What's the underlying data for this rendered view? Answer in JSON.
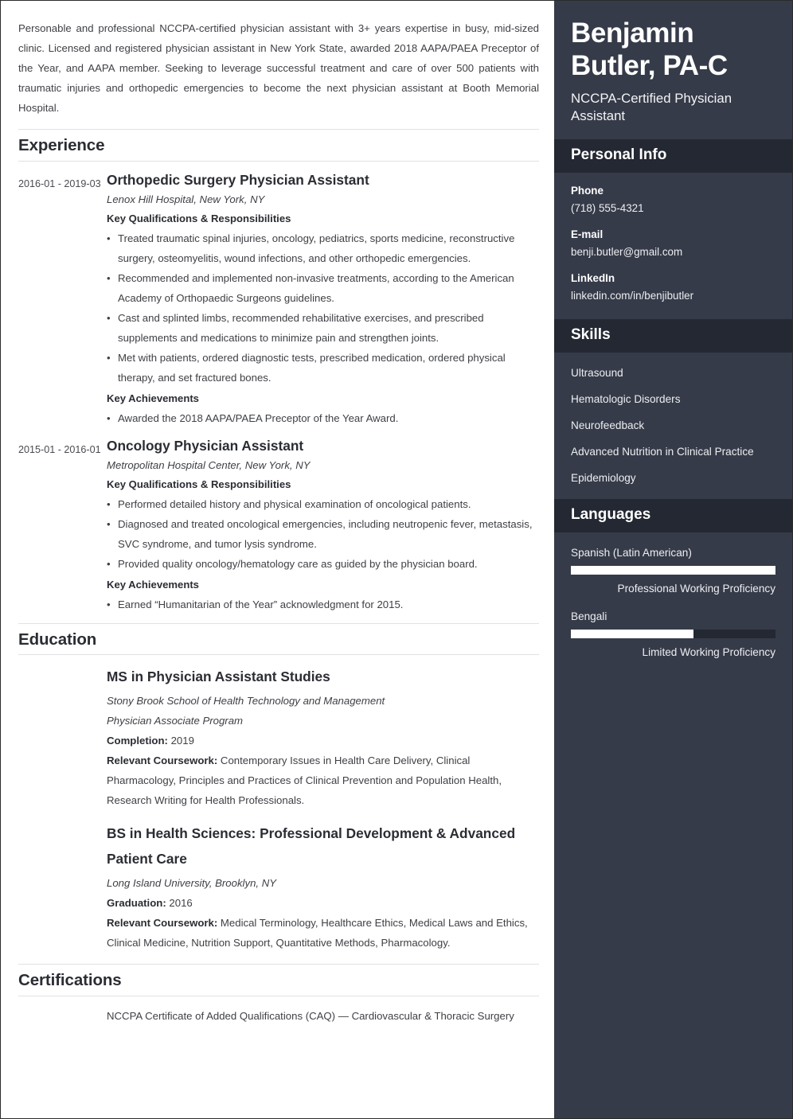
{
  "colors": {
    "sidebar_bg": "#363b49",
    "sidebar_band_bg": "#232832",
    "page_bg": "#ffffff",
    "heading_text": "#2b2d33",
    "body_text": "#3f4045",
    "rule": "#e2e2e2",
    "bar_fill": "#ffffff"
  },
  "summary": "Personable and professional NCCPA-certified physician assistant with 3+ years expertise in busy, mid-sized clinic. Licensed and registered physician assistant in New York State, awarded 2018 AAPA/PAEA Preceptor of the Year, and AAPA member. Seeking to leverage successful treatment and care of over 500 patients with traumatic injuries and orthopedic emergencies to become the next physician assistant at Booth Memorial Hospital.",
  "sections": {
    "experience_title": "Experience",
    "education_title": "Education",
    "certifications_title": "Certifications"
  },
  "experience": [
    {
      "dates": "2016-01 - 2019-03",
      "title": "Orthopedic Surgery Physician Assistant",
      "employer": "Lenox Hill Hospital, New York, NY",
      "qualifications_label": "Key Qualifications & Responsibilities",
      "bullets": [
        "Treated traumatic spinal injuries, oncology, pediatrics, sports medicine, reconstructive surgery, osteomyelitis, wound infections, and other orthopedic emergencies.",
        "Recommended and implemented non-invasive treatments, according to the American Academy of Orthopaedic Surgeons guidelines.",
        "Cast and splinted limbs, recommended rehabilitative exercises, and prescribed supplements and medications to minimize pain and strengthen joints.",
        "Met with patients, ordered diagnostic tests, prescribed medication, ordered physical therapy, and set fractured bones."
      ],
      "achievements_label": "Key Achievements",
      "achievements": [
        "Awarded the 2018 AAPA/PAEA Preceptor of the Year Award."
      ]
    },
    {
      "dates": "2015-01 - 2016-01",
      "title": "Oncology Physician Assistant",
      "employer": "Metropolitan Hospital Center, New York, NY",
      "qualifications_label": "Key Qualifications & Responsibilities",
      "bullets": [
        "Performed detailed history and physical examination of oncological patients.",
        "Diagnosed and treated oncological emergencies, including neutropenic fever, metastasis, SVC syndrome, and tumor lysis syndrome.",
        "Provided quality oncology/hematology care as guided by the physician board."
      ],
      "achievements_label": "Key Achievements",
      "achievements": [
        "Earned “Humanitarian of the Year” acknowledgment for 2015."
      ]
    }
  ],
  "education": [
    {
      "degree": "MS in Physician Assistant Studies",
      "school": "Stony Brook School of Health Technology and Management",
      "program": "Physician Associate Program",
      "date_label": "Completion:",
      "date_value": "2019",
      "coursework_label": "Relevant Coursework:",
      "coursework_value": "Contemporary Issues in Health Care Delivery, Clinical Pharmacology, Principles and Practices of Clinical Prevention and Population Health, Research Writing for Health Professionals."
    },
    {
      "degree": "BS in Health Sciences: Professional Development & Advanced Patient Care",
      "school": "Long Island University, Brooklyn, NY",
      "program": "",
      "date_label": "Graduation:",
      "date_value": "2016",
      "coursework_label": "Relevant Coursework:",
      "coursework_value": "Medical Terminology, Healthcare Ethics, Medical Laws and Ethics, Clinical Medicine, Nutrition Support, Quantitative Methods, Pharmacology."
    }
  ],
  "certifications": [
    "NCCPA Certificate of Added Qualifications (CAQ) — Cardiovascular & Thoracic Surgery"
  ],
  "sidebar": {
    "name": "Benjamin Butler, PA-C",
    "role": "NCCPA-Certified Physician Assistant",
    "personal_info_title": "Personal Info",
    "contacts": [
      {
        "label": "Phone",
        "value": "(718) 555-4321"
      },
      {
        "label": "E-mail",
        "value": "benji.butler@gmail.com"
      },
      {
        "label": "LinkedIn",
        "value": "linkedin.com/in/benjibutler"
      }
    ],
    "skills_title": "Skills",
    "skills": [
      "Ultrasound",
      "Hematologic Disorders",
      "Neurofeedback",
      "Advanced Nutrition in Clinical Practice",
      "Epidemiology"
    ],
    "languages_title": "Languages",
    "languages": [
      {
        "name": "Spanish (Latin American)",
        "level": "Professional Working Proficiency",
        "percent": 100
      },
      {
        "name": "Bengali",
        "level": "Limited Working Proficiency",
        "percent": 60
      }
    ]
  }
}
